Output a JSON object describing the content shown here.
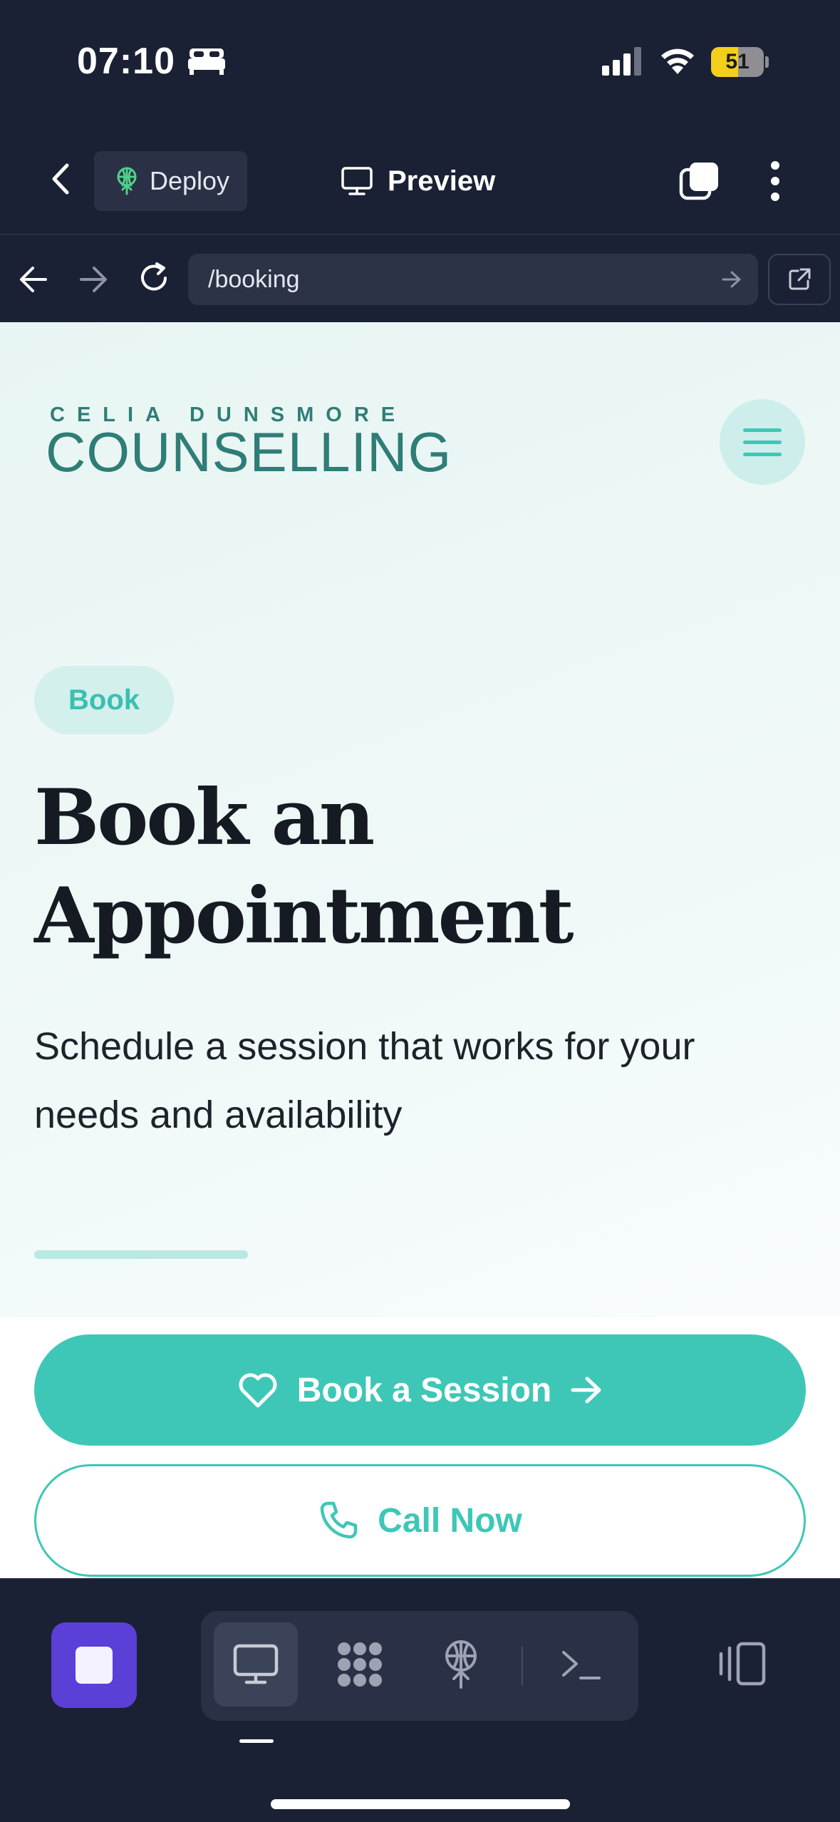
{
  "status_bar": {
    "time": "07:10",
    "battery_level": "51",
    "battery_fraction": 0.51,
    "icons": [
      "bed-icon",
      "signal-icon",
      "wifi-icon",
      "battery-icon"
    ]
  },
  "app_header": {
    "deploy_label": "Deploy",
    "preview_label": "Preview",
    "icons": [
      "chevron-left-icon",
      "deploy-icon",
      "monitor-icon",
      "tabs-icon",
      "more-vertical-icon"
    ]
  },
  "browser": {
    "url": "/booking",
    "icons": [
      "arrow-left-icon",
      "arrow-right-icon",
      "reload-icon",
      "go-arrow-icon",
      "external-link-icon"
    ]
  },
  "site": {
    "logo_top": "CELIA DUNSMORE",
    "logo_main": "COUNSELLING",
    "badge": "Book",
    "title_line1": "Book an",
    "title_line2": "Appointment",
    "subtitle": "Schedule a session that works for your needs and availability",
    "primary_cta": "Book a Session",
    "secondary_cta": "Call Now",
    "colors": {
      "accent": "#3ec7b6",
      "logo": "#2f7d77",
      "badge_bg": "#d3f0ec"
    }
  },
  "toolbar": {
    "icons": [
      "stop-icon",
      "desktop-icon",
      "grid-icon",
      "deploy-icon",
      "terminal-icon",
      "layout-icon"
    ],
    "accent": "#5b3fd6"
  }
}
